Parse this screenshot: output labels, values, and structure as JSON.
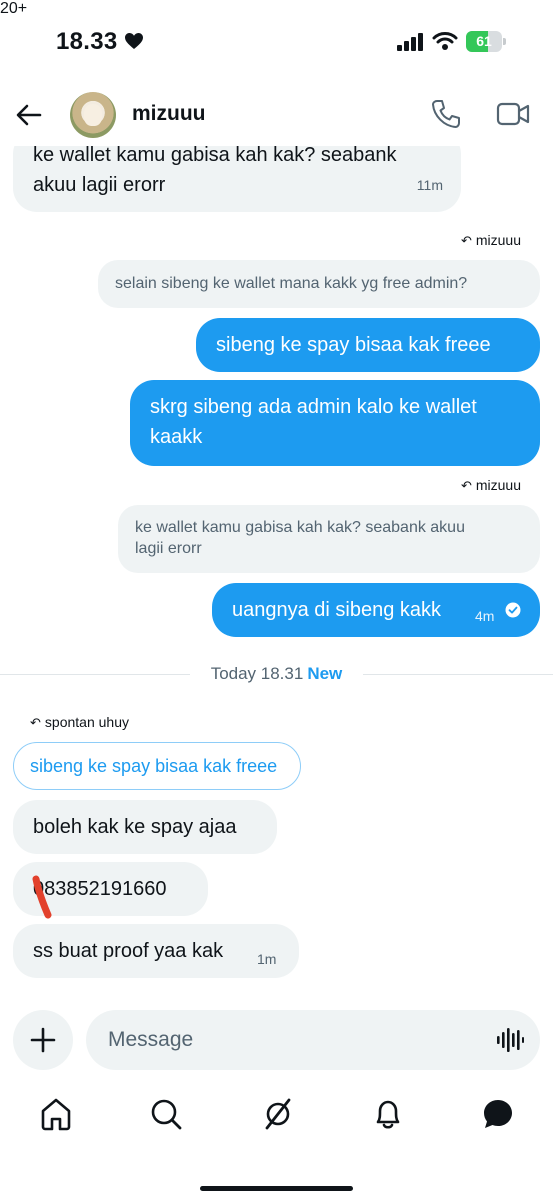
{
  "status_bar": {
    "time": "18.33",
    "battery": "61",
    "battery_level": 0.61,
    "battery_color": "#34c759"
  },
  "header": {
    "name": "mizuuu",
    "icons": [
      "back-arrow-icon",
      "avatar",
      "phone-icon",
      "video-icon"
    ]
  },
  "messages": {
    "m1": {
      "text_line1": "ke wallet kamu gabisa kah kak? seabank",
      "text_line2": "akuu lagii erorr",
      "time": "11m"
    },
    "reply_tag_1": "mizuuu",
    "quoted_1": "selain sibeng ke wallet mana kakk yg free admin?",
    "m2": {
      "text": "sibeng ke spay bisaa kak freee"
    },
    "m3": {
      "text_line1": "skrg sibeng ada admin kalo ke wallet",
      "text_line2": "kaakk"
    },
    "reply_tag_2": "mizuuu",
    "quoted_2": {
      "line1": "ke wallet kamu gabisa kah kak? seabank akuu",
      "line2": "lagii erorr"
    },
    "m4": {
      "text": "uangnya di sibeng kakk",
      "time": "4m"
    },
    "divider": {
      "label": "Today 18.31",
      "new": "New"
    },
    "reply_tag_3": "spontan uhuy",
    "quoted_3": "sibeng ke spay bisaa kak freee",
    "m5": {
      "text": "boleh kak ke spay ajaa"
    },
    "m6": {
      "text": "083852191660"
    },
    "m7": {
      "text": "ss buat proof yaa kak",
      "time": "1m"
    }
  },
  "composer": {
    "placeholder": "Message"
  },
  "nav": {
    "items": [
      "home-icon",
      "search-icon",
      "grok-icon",
      "notifications-icon",
      "messages-icon"
    ],
    "badge": "20+"
  },
  "colors": {
    "accent": "#1d9bf0",
    "incoming_bubble": "#eff3f4",
    "text": "#0f1419",
    "muted": "#536471",
    "redaction": "#e2412c"
  }
}
